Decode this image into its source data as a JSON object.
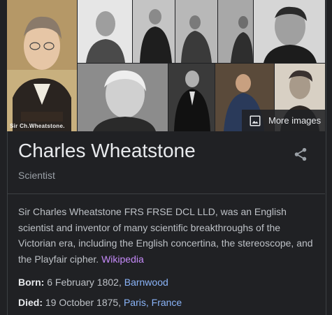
{
  "images": {
    "main_caption": "Sir Ch.Wheatstone.",
    "more_label": "More images"
  },
  "entity": {
    "name": "Charles Wheatstone",
    "type": "Scientist"
  },
  "description": {
    "text": "Sir Charles Wheatstone FRS FRSE DCL LLD, was an English scientist and inventor of many scientific breakthroughs of the Victorian era, including the English concertina, the stereoscope, and the Playfair cipher. ",
    "source_link": "Wikipedia"
  },
  "facts": {
    "born_label": "Born:",
    "born_value": " 6 February 1802, ",
    "born_place": "Barnwood",
    "died_label": "Died:",
    "died_value": " 19 October 1875, ",
    "died_place": "Paris, France"
  },
  "colors": {
    "background": "#202124",
    "title": "#e8eaed",
    "link_blue": "#8ab4f8",
    "link_purple": "#c58af9"
  }
}
